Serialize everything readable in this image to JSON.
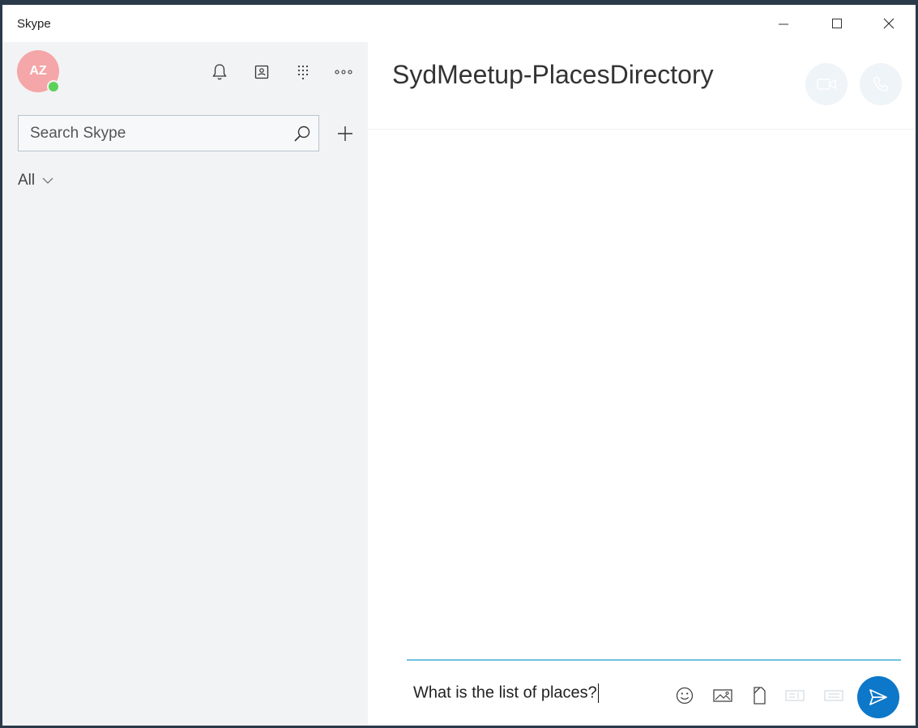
{
  "window": {
    "title": "Skype"
  },
  "sidebar": {
    "avatar_initials": "AZ",
    "presence_color": "#5bd15b",
    "top_icons": [
      "bell-icon",
      "contacts-icon",
      "dialpad-icon",
      "more-icon"
    ],
    "search": {
      "placeholder": "Search Skype",
      "value": ""
    },
    "add_icon": "plus-icon",
    "filter": {
      "label": "All"
    }
  },
  "chat": {
    "title": "SydMeetup-PlacesDirectory",
    "call_buttons": [
      "video-call-icon",
      "audio-call-icon"
    ],
    "composer": {
      "message": "What is the list of places?",
      "icons": [
        "emoji-icon",
        "image-icon",
        "file-icon",
        "contact-card-icon",
        "more-options-icon"
      ],
      "send_icon": "send-icon"
    }
  },
  "colors": {
    "accent": "#0d78c9",
    "avatar_bg": "#f4a6a8",
    "sidebar_bg": "#f2f3f4",
    "composer_line": "#6fc1e0"
  }
}
